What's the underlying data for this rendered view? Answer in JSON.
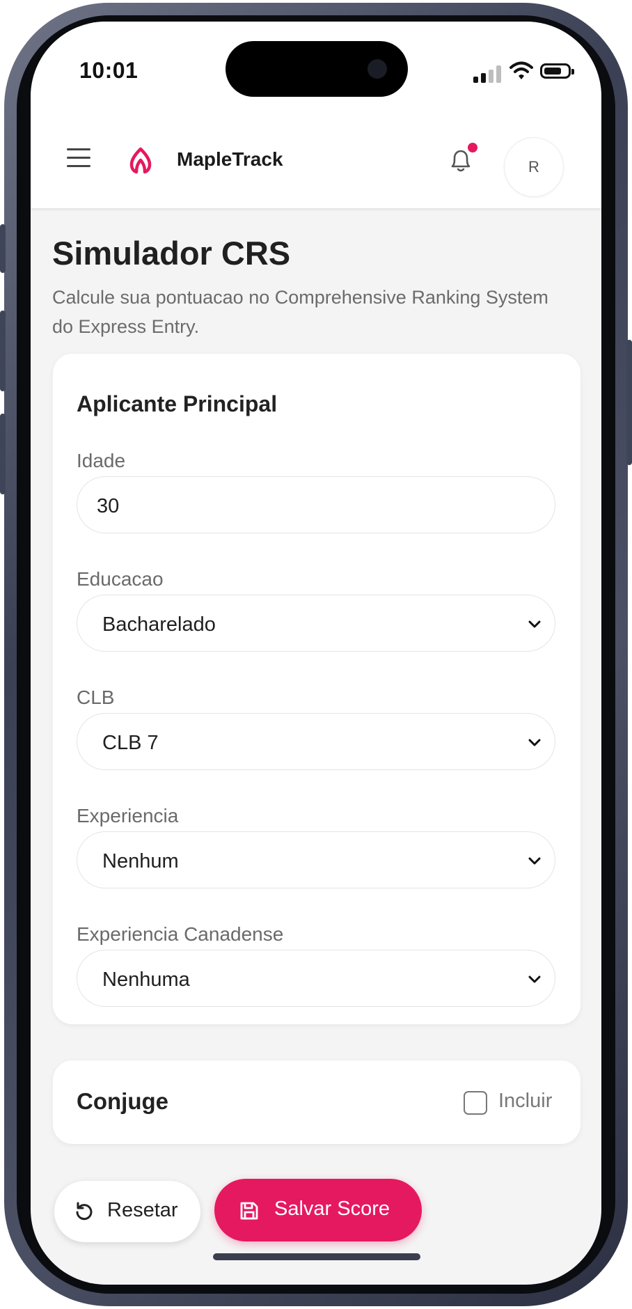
{
  "status_bar": {
    "time": "10:01"
  },
  "header": {
    "brand": "MapleTrack",
    "avatar_initial": "R",
    "has_notification": true,
    "accent_color": "#e5195f"
  },
  "page": {
    "title": "Simulador CRS",
    "subtitle": "Calcule sua pontuacao no Comprehensive Ranking System do Express Entry."
  },
  "main_card": {
    "title": "Aplicante Principal",
    "fields": {
      "age": {
        "label": "Idade",
        "value": "30"
      },
      "education": {
        "label": "Educacao",
        "value": "Bacharelado"
      },
      "clb": {
        "label": "CLB",
        "value": "CLB 7"
      },
      "experience": {
        "label": "Experiencia",
        "value": "Nenhum"
      },
      "canadian_experience": {
        "label": "Experiencia Canadense",
        "value": "Nenhuma"
      }
    }
  },
  "spouse_card": {
    "title": "Conjuge",
    "include_label": "Incluir",
    "include_checked": false
  },
  "actions": {
    "reset_label": "Resetar",
    "save_label": "Salvar Score"
  },
  "icons": {
    "menu": "menu-icon",
    "logo": "maple-logo-icon",
    "bell": "bell-icon",
    "select": "chevron-down-icon",
    "reset": "refresh-icon",
    "save": "save-icon"
  }
}
